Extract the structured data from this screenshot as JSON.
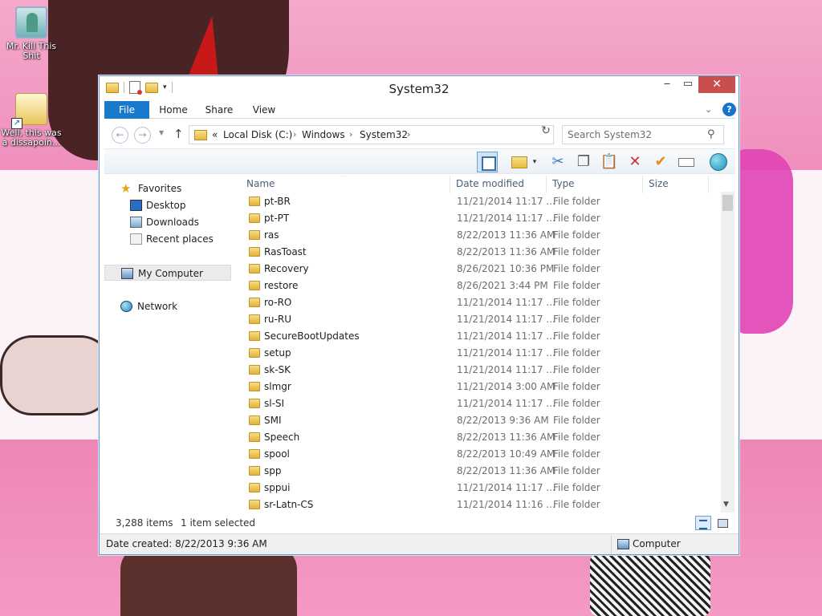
{
  "desktop": {
    "icons": [
      {
        "label": "Mr. Kill This Shit"
      },
      {
        "label": "Well, this was a dissapoin..."
      }
    ]
  },
  "window": {
    "title": "System32",
    "ribbon_tabs": [
      "File",
      "Home",
      "Share",
      "View"
    ],
    "help_glyph": "?"
  },
  "address": {
    "overflow": "«",
    "crumbs": [
      "Local Disk (C:)",
      "Windows",
      "System32"
    ],
    "search_placeholder": "Search System32"
  },
  "nav_pane": {
    "favorites_label": "Favorites",
    "favorites": [
      "Desktop",
      "Downloads",
      "Recent places"
    ],
    "my_computer": "My Computer",
    "network": "Network"
  },
  "columns": {
    "name": "Name",
    "date": "Date modified",
    "type": "Type",
    "size": "Size"
  },
  "files": [
    {
      "name": "pt-BR",
      "date": "11/21/2014 11:17 ...",
      "type": "File folder"
    },
    {
      "name": "pt-PT",
      "date": "11/21/2014 11:17 ...",
      "type": "File folder"
    },
    {
      "name": "ras",
      "date": "8/22/2013 11:36 AM",
      "type": "File folder"
    },
    {
      "name": "RasToast",
      "date": "8/22/2013 11:36 AM",
      "type": "File folder"
    },
    {
      "name": "Recovery",
      "date": "8/26/2021 10:36 PM",
      "type": "File folder"
    },
    {
      "name": "restore",
      "date": "8/26/2021 3:44 PM",
      "type": "File folder"
    },
    {
      "name": "ro-RO",
      "date": "11/21/2014 11:17 ...",
      "type": "File folder"
    },
    {
      "name": "ru-RU",
      "date": "11/21/2014 11:17 ...",
      "type": "File folder"
    },
    {
      "name": "SecureBootUpdates",
      "date": "11/21/2014 11:17 ...",
      "type": "File folder"
    },
    {
      "name": "setup",
      "date": "11/21/2014 11:17 ...",
      "type": "File folder"
    },
    {
      "name": "sk-SK",
      "date": "11/21/2014 11:17 ...",
      "type": "File folder"
    },
    {
      "name": "slmgr",
      "date": "11/21/2014 3:00 AM",
      "type": "File folder"
    },
    {
      "name": "sl-SI",
      "date": "11/21/2014 11:17 ...",
      "type": "File folder"
    },
    {
      "name": "SMI",
      "date": "8/22/2013 9:36 AM",
      "type": "File folder"
    },
    {
      "name": "Speech",
      "date": "8/22/2013 11:36 AM",
      "type": "File folder"
    },
    {
      "name": "spool",
      "date": "8/22/2013 10:49 AM",
      "type": "File folder"
    },
    {
      "name": "spp",
      "date": "8/22/2013 11:36 AM",
      "type": "File folder"
    },
    {
      "name": "sppui",
      "date": "11/21/2014 11:17 ...",
      "type": "File folder"
    },
    {
      "name": "sr-Latn-CS",
      "date": "11/21/2014 11:16 ...",
      "type": "File folder"
    }
  ],
  "status": {
    "item_count": "3,288 items",
    "selected": "1 item selected"
  },
  "details": {
    "date_created": "Date created: 8/22/2013 9:36 AM",
    "location": "Computer"
  }
}
